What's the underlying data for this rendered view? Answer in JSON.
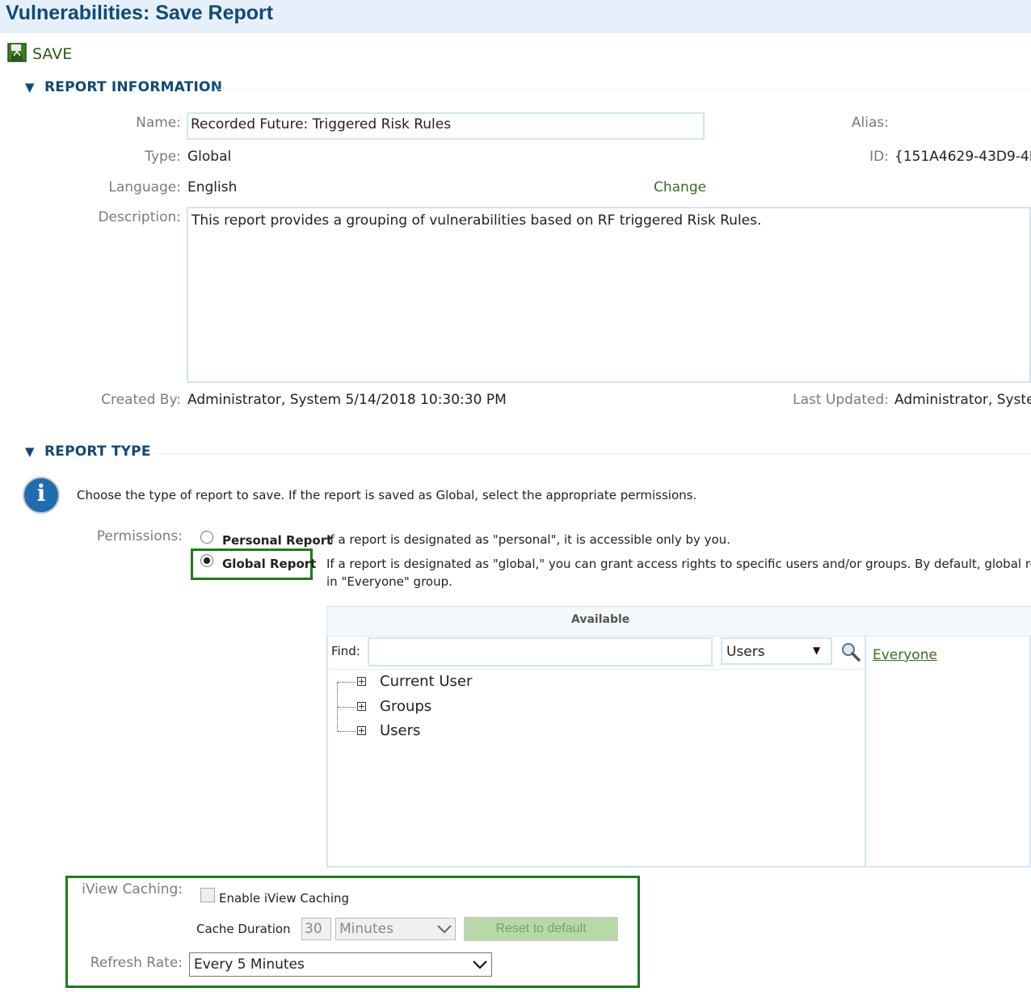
{
  "page": {
    "title": "Vulnerabilities: Save Report"
  },
  "toolbar": {
    "save_label": "SAVE"
  },
  "report_information": {
    "heading": "REPORT INFORMATION",
    "name_label": "Name:",
    "name_value": "Recorded Future: Triggered Risk Rules",
    "alias_label": "Alias:",
    "type_label": "Type:",
    "type_value": "Global",
    "id_label": "ID:",
    "id_value": "{151A4629-43D9-4E",
    "language_label": "Language:",
    "language_value": "English",
    "change_link": "Change",
    "description_label": "Description:",
    "description_value": "This report provides a grouping of vulnerabilities based on RF triggered Risk Rules.",
    "created_by_label": "Created By:",
    "created_by_value": "Administrator, System 5/14/2018 10:30:30 PM",
    "last_updated_label": "Last Updated:",
    "last_updated_value": "Administrator, Syste"
  },
  "report_type": {
    "heading": "REPORT TYPE",
    "info_text": "Choose the type of report to save. If the report is saved as Global, select the appropriate permissions.",
    "permissions_label": "Permissions:",
    "personal_label": "Personal Report",
    "personal_desc": "If a report is designated as \"personal\", it is accessible only by you.",
    "global_label": "Global Report",
    "global_desc_1": "If a report is designated as \"global,\" you can grant access rights to specific users and/or groups. By default, global report",
    "global_desc_2": "in \"Everyone\" group.",
    "selected": "Global Report"
  },
  "available": {
    "header": "Available",
    "find_label": "Find:",
    "find_value": "",
    "filter_selected": "Users",
    "tree": [
      "Current User",
      "Groups",
      "Users"
    ],
    "selected_list": [
      "Everyone"
    ]
  },
  "caching": {
    "iview_label": "iView Caching:",
    "enable_label": "Enable iView Caching",
    "enabled": false,
    "duration_label": "Cache Duration",
    "duration_value": "30",
    "duration_unit": "Minutes",
    "reset_label": "Reset to default",
    "refresh_label": "Refresh Rate:",
    "refresh_value": "Every 5 Minutes"
  },
  "icons": {
    "save": "save-disk-icon",
    "section_toggle": "triangle-down-icon",
    "info": "info-icon",
    "search": "magnifier-icon",
    "dropdown": "chevron-down-icon",
    "tree_expand": "plus-box-icon"
  },
  "colors": {
    "title": "#0f4a78",
    "title_bg": "#e6f0fa",
    "highlight_border": "#1e7a1e",
    "link_green": "#3d6b22"
  }
}
